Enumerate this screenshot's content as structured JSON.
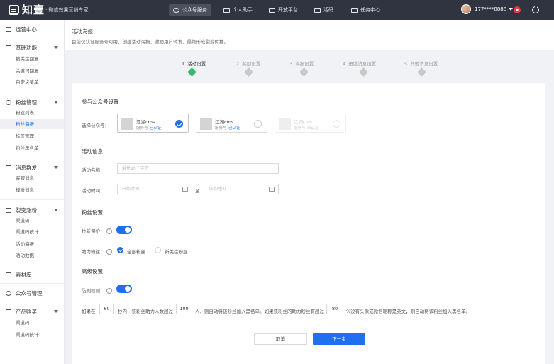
{
  "brand": {
    "name": "知壹",
    "slogan": "· 微信效果营销专家"
  },
  "topnav": [
    {
      "label": "公众号服务",
      "active": true,
      "icon": "chat-icon"
    },
    {
      "label": "个人助手",
      "active": false,
      "icon": "briefcase-icon"
    },
    {
      "label": "开放平台",
      "active": false,
      "icon": "monitor-icon"
    },
    {
      "label": "活码",
      "active": false,
      "icon": "qrcode-icon"
    },
    {
      "label": "任务中心",
      "active": false,
      "icon": "task-icon"
    }
  ],
  "user": {
    "phone": "177****8888"
  },
  "sidebar": [
    {
      "label": "运营中心",
      "icon": "chart-icon",
      "items": []
    },
    {
      "label": "基础功能",
      "icon": "grid-icon",
      "items": [
        "被关注回复",
        "关键词回复",
        "自定义菜单"
      ]
    },
    {
      "label": "粉丝管理",
      "icon": "heart-icon",
      "items": [
        "粉丝列表",
        "粉丝海报",
        "标签管理",
        "粉丝黑名单"
      ]
    },
    {
      "label": "消息群发",
      "icon": "message-icon",
      "items": [
        "客服消息",
        "模板消息"
      ]
    },
    {
      "label": "裂变涨粉",
      "icon": "share-icon",
      "items": [
        "渠道码",
        "渠道码统计",
        "活动海报",
        "活动数据"
      ]
    },
    {
      "label": "素材库",
      "icon": "folder-icon",
      "items": []
    },
    {
      "label": "公众号管理",
      "icon": "user-icon",
      "items": []
    },
    {
      "label": "产品购买",
      "icon": "cart-icon",
      "items": [
        "渠道码",
        "渠道码统计"
      ]
    }
  ],
  "page": {
    "title": "活动海报",
    "desc": "目前仅认证服务号可用，创建活动海报，激励用户转发，最终形成裂变传播。"
  },
  "steps": [
    "1. 活动设置",
    "2. 奖励设置",
    "3. 海报设置",
    "4. 进度消息设置",
    "5. 其他消息设置"
  ],
  "sections": {
    "account": "参与公众号设置",
    "activity": "活动信息",
    "fans": "粉丝设置",
    "advanced": "高级设置"
  },
  "form": {
    "select_account_label": "选择公众号：",
    "accounts": [
      {
        "name": "江湖cms",
        "type": "服务号",
        "verified": "已认证"
      },
      {
        "name": "江湖cms",
        "type": "服务号",
        "verified": "已认证"
      },
      {
        "name": "江湖cms",
        "type": "服务号",
        "verified": "未认证"
      }
    ],
    "activity_name_label": "活动名称：",
    "activity_name_placeholder": "最长16个字符",
    "activity_time_label": "活动时间：",
    "start_placeholder": "开始时间",
    "end_placeholder": "结束时间",
    "to": "至",
    "protect_label": "拉新保护：",
    "help_fans_label": "助力粉丝：",
    "help_options": [
      "全部粉丝",
      "新关注粉丝"
    ],
    "anti_brush_label": "防刷检测：",
    "rule": {
      "p1": "如果在",
      "v1": "60",
      "p2": "秒内，该粉丝助力人数超过",
      "v2": "100",
      "p3": "人，则自动将该粉丝加入黑名单。如果该粉丝的助力粉丝有超过",
      "v3": "80",
      "p4": "%没有头像或微信昵称是英文，则自动将该粉丝加入黑名单。"
    }
  },
  "buttons": {
    "cancel": "取消",
    "next": "下一步"
  },
  "colors": {
    "primary": "#1f6ff0",
    "step_active": "#3bb96a",
    "topbar": "#2f3440"
  }
}
